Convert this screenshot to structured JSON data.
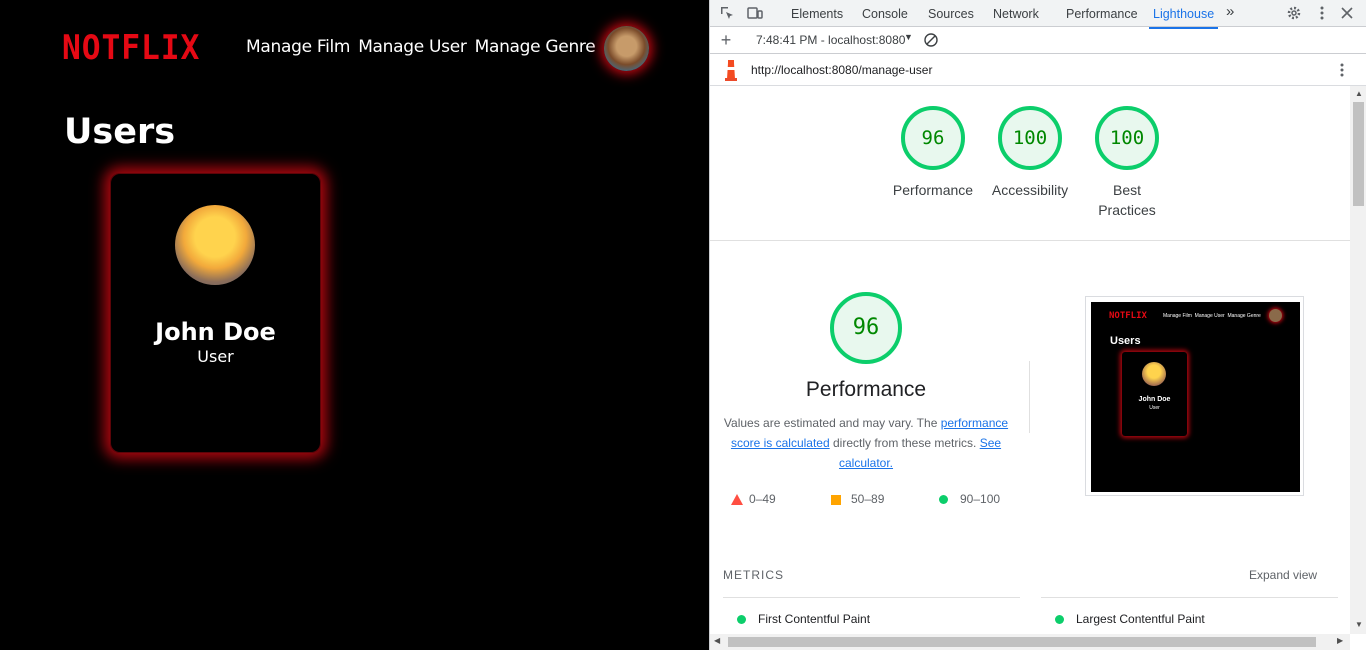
{
  "site": {
    "logo": "NOTFLIX",
    "nav": [
      "Manage Film",
      "Manage User",
      "Manage Genre"
    ],
    "page_title": "Users",
    "user_card": {
      "name": "John Doe",
      "role": "User"
    },
    "accent": "#e50914"
  },
  "devtools": {
    "tabs": [
      "Elements",
      "Console",
      "Sources",
      "Network",
      "Performance",
      "Lighthouse"
    ],
    "active_tab": "Lighthouse",
    "more_tabs": "»",
    "report_selector": "7:48:41 PM - localhost:8080",
    "url": "http://localhost:8080/manage-user",
    "scores": [
      {
        "label": "Performance",
        "value": "96"
      },
      {
        "label": "Accessibility",
        "value": "100"
      },
      {
        "label": "Best Practices",
        "value": "100"
      }
    ],
    "performance": {
      "score": "96",
      "title": "Performance",
      "desc_before": "Values are estimated and may vary. The ",
      "desc_link1": "performance score is calculated",
      "desc_middle": " directly from these metrics. ",
      "desc_link2": "See calculator."
    },
    "legend": [
      {
        "range": "0–49",
        "color": "#ff4e42"
      },
      {
        "range": "50–89",
        "color": "#ffa400"
      },
      {
        "range": "90–100",
        "color": "#0cce6b"
      }
    ],
    "thumbnail": {
      "logo": "NOTFLIX",
      "nav": "Manage Film  Manage User  Manage Genre",
      "title": "Users",
      "name": "John Doe",
      "role": "User"
    },
    "metrics_heading": "METRICS",
    "expand_view": "Expand view",
    "metrics": [
      "First Contentful Paint",
      "Largest Contentful Paint"
    ],
    "good_color": "#0cce6b"
  }
}
